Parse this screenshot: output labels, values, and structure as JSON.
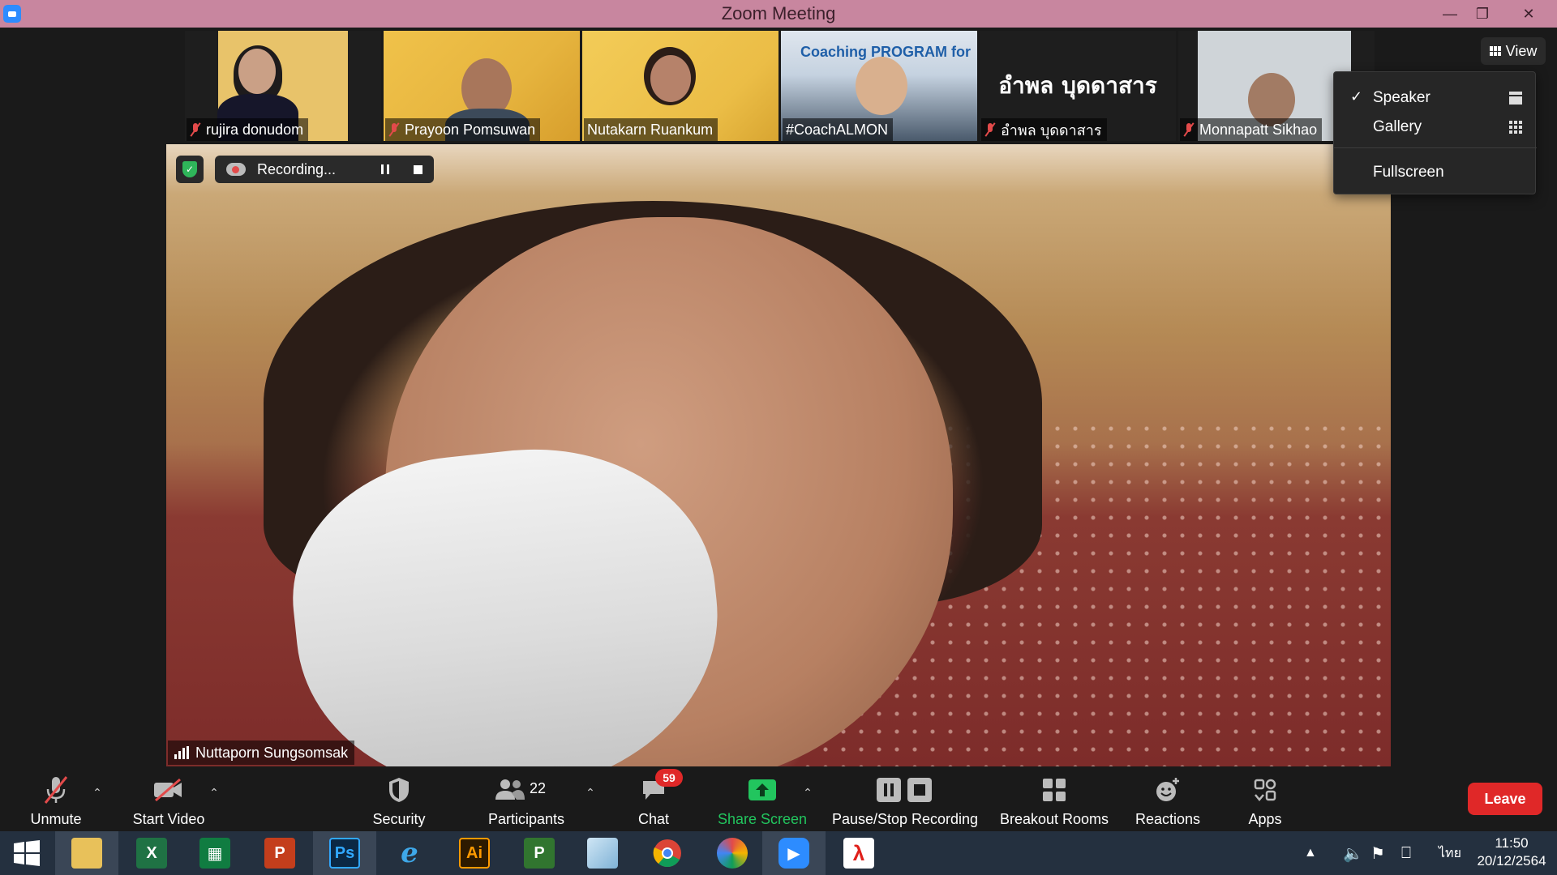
{
  "window": {
    "title": "Zoom Meeting"
  },
  "thumbnails": [
    {
      "name": "rujira donudom",
      "muted": true
    },
    {
      "name": "Prayoon Pomsuwan",
      "muted": true
    },
    {
      "name": "Nutakarn Ruankum",
      "muted": false
    },
    {
      "name": "#CoachALMON",
      "muted": false,
      "banner": "Coaching PROGRAM for"
    },
    {
      "name": "อำพล บุดดาสาร",
      "muted": true,
      "display_text": "อำพล บุดดาสาร"
    },
    {
      "name": "Monnapatt Sikhao",
      "muted": true
    }
  ],
  "recording": {
    "label": "Recording..."
  },
  "speaker": {
    "name": "Nuttaporn Sungsomsak"
  },
  "view": {
    "button_label": "View",
    "menu": [
      {
        "label": "Speaker",
        "checked": true
      },
      {
        "label": "Gallery",
        "checked": false
      },
      {
        "label": "Fullscreen",
        "checked": false
      }
    ]
  },
  "toolbar": {
    "unmute": "Unmute",
    "start_video": "Start Video",
    "security": "Security",
    "participants": "Participants",
    "participants_count": "22",
    "chat": "Chat",
    "chat_badge": "59",
    "share_screen": "Share Screen",
    "pause_stop_recording": "Pause/Stop Recording",
    "breakout_rooms": "Breakout Rooms",
    "reactions": "Reactions",
    "apps": "Apps",
    "leave": "Leave"
  },
  "taskbar": {
    "apps": [
      "windows-start",
      "file-explorer",
      "excel",
      "publisher-green",
      "powerpoint",
      "photoshop",
      "internet-explorer",
      "illustrator",
      "project",
      "notepad-style",
      "chrome",
      "photoscape",
      "zoom",
      "acrobat"
    ],
    "ps_label": "Ps",
    "ai_label": "Ai",
    "language": "ไทย",
    "time": "11:50",
    "date": "20/12/2564"
  },
  "colors": {
    "titlebar": "#c8869f",
    "leave": "#e02828",
    "share_green": "#22c55e",
    "muted_red": "#e24a4a",
    "taskbar": "#24303f"
  }
}
